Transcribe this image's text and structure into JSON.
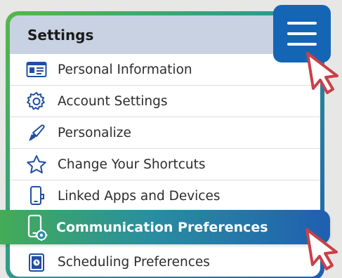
{
  "settings": {
    "title": "Settings"
  },
  "menu": {
    "items": [
      {
        "label": "Personal Information",
        "icon": "id-card-icon"
      },
      {
        "label": "Account Settings",
        "icon": "gear-icon"
      },
      {
        "label": "Personalize",
        "icon": "paintbrush-icon"
      },
      {
        "label": "Change Your Shortcuts",
        "icon": "star-icon"
      },
      {
        "label": "Linked Apps and Devices",
        "icon": "phone-icon"
      },
      {
        "label": "Communication Preferences",
        "icon": "phone-gear-icon"
      },
      {
        "label": "Scheduling Preferences",
        "icon": "schedule-icon"
      }
    ]
  },
  "hamburger": {
    "icon": "hamburger-menu-icon"
  },
  "colors": {
    "header_bg": "#c8d2e3",
    "accent_blue": "#1565b5",
    "accent_green": "#55b84a",
    "icon_blue": "#1f4fa3"
  }
}
